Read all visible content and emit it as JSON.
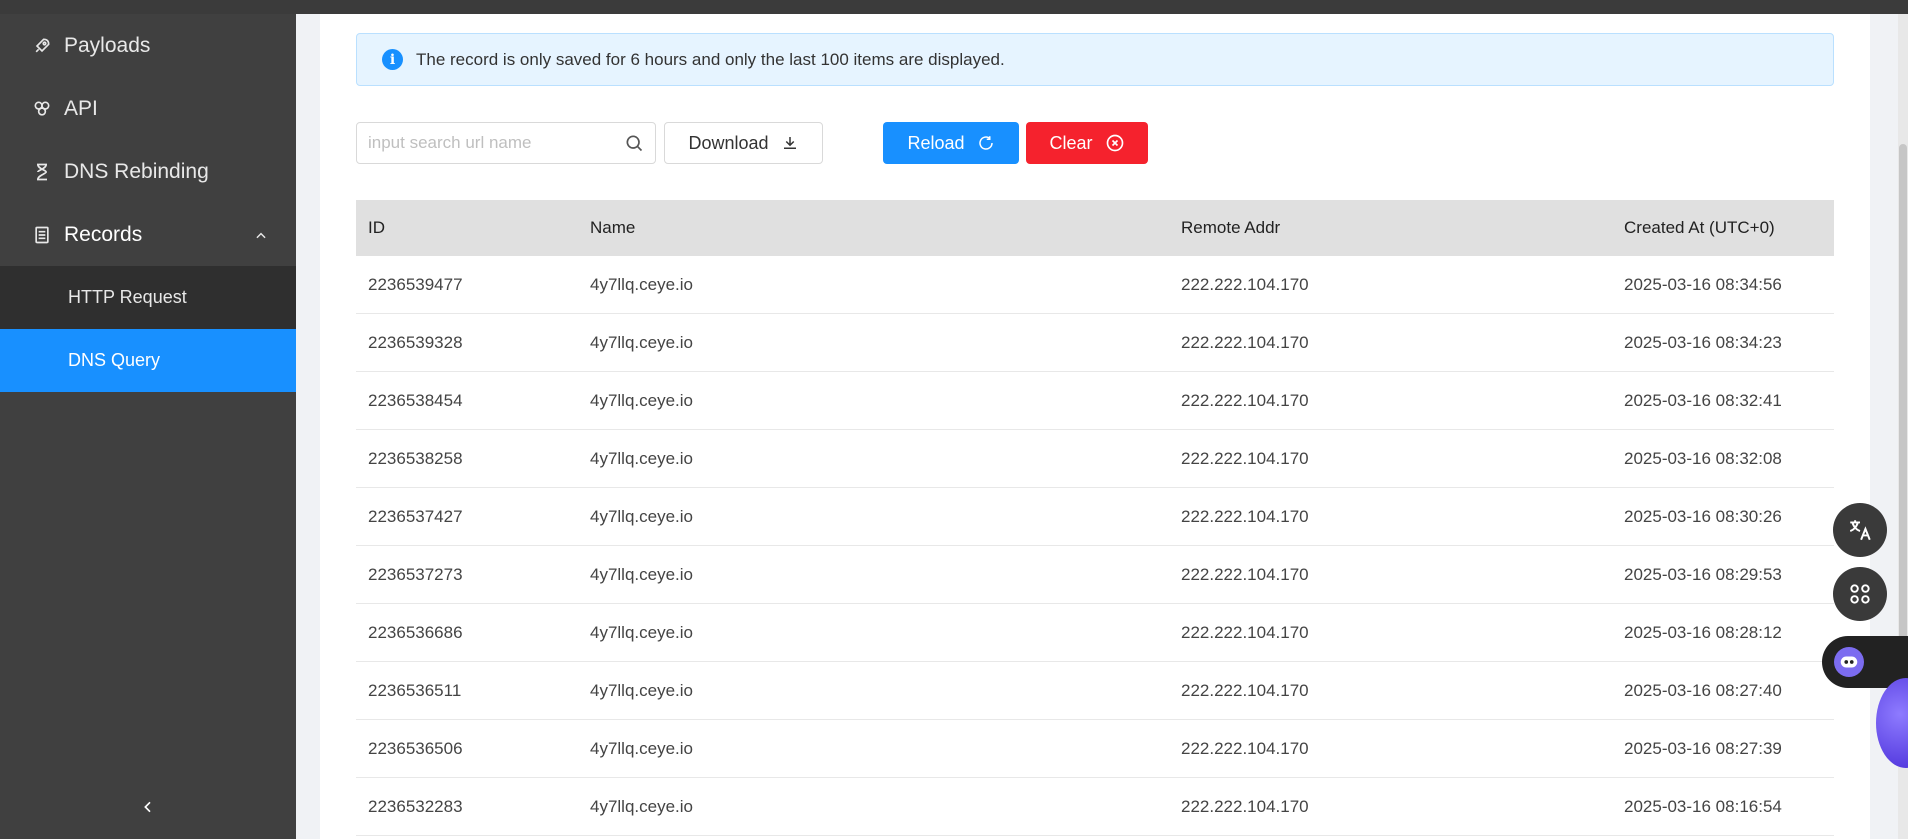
{
  "sidebar": {
    "items": [
      {
        "label": "Payloads",
        "icon": "rocket-icon"
      },
      {
        "label": "API",
        "icon": "api-icon"
      },
      {
        "label": "DNS Rebinding",
        "icon": "hourglass-icon"
      },
      {
        "label": "Records",
        "icon": "server-icon",
        "expanded": true
      }
    ],
    "sub_items": [
      {
        "label": "HTTP Request",
        "active": false
      },
      {
        "label": "DNS Query",
        "active": true
      }
    ]
  },
  "alert": {
    "text": "The record is only saved for 6 hours and only the last 100 items are displayed."
  },
  "toolbar": {
    "search_placeholder": "input search url name",
    "search_value": "",
    "download_label": "Download",
    "reload_label": "Reload",
    "clear_label": "Clear"
  },
  "table": {
    "headers": [
      "ID",
      "Name",
      "Remote Addr",
      "Created At (UTC+0)"
    ],
    "rows": [
      [
        "2236539477",
        "4y7llq.ceye.io",
        "222.222.104.170",
        "2025-03-16 08:34:56"
      ],
      [
        "2236539328",
        "4y7llq.ceye.io",
        "222.222.104.170",
        "2025-03-16 08:34:23"
      ],
      [
        "2236538454",
        "4y7llq.ceye.io",
        "222.222.104.170",
        "2025-03-16 08:32:41"
      ],
      [
        "2236538258",
        "4y7llq.ceye.io",
        "222.222.104.170",
        "2025-03-16 08:32:08"
      ],
      [
        "2236537427",
        "4y7llq.ceye.io",
        "222.222.104.170",
        "2025-03-16 08:30:26"
      ],
      [
        "2236537273",
        "4y7llq.ceye.io",
        "222.222.104.170",
        "2025-03-16 08:29:53"
      ],
      [
        "2236536686",
        "4y7llq.ceye.io",
        "222.222.104.170",
        "2025-03-16 08:28:12"
      ],
      [
        "2236536511",
        "4y7llq.ceye.io",
        "222.222.104.170",
        "2025-03-16 08:27:40"
      ],
      [
        "2236536506",
        "4y7llq.ceye.io",
        "222.222.104.170",
        "2025-03-16 08:27:39"
      ],
      [
        "2236532283",
        "4y7llq.ceye.io",
        "222.222.104.170",
        "2025-03-16 08:16:54"
      ]
    ]
  },
  "colors": {
    "primary": "#1890ff",
    "danger": "#f5222d",
    "sidebar": "#404040"
  }
}
